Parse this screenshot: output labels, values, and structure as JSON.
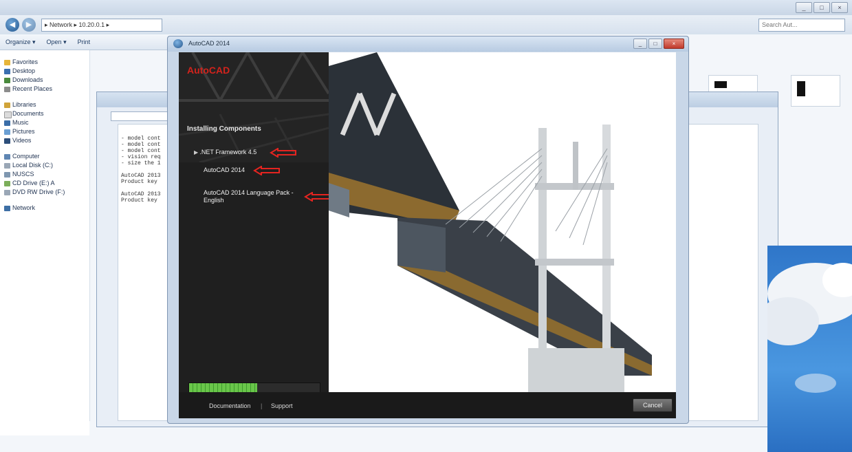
{
  "explorer": {
    "address": "▸ Network ▸ 10.20.0.1 ▸",
    "search_placeholder": "Search Aut...",
    "toolbar": {
      "organize": "Organize ▾",
      "open": "Open ▾",
      "print": "Print"
    },
    "nav_favorites": [
      "Favorites",
      "Desktop",
      "Downloads",
      "Recent Places"
    ],
    "nav_libraries": [
      "Libraries",
      "Documents",
      "Music",
      "Pictures",
      "Videos"
    ],
    "nav_computer": [
      "Computer",
      "Local Disk (C:)",
      "NUSCS",
      "CD Drive (E:) A",
      "DVD RW Drive (F:)"
    ],
    "nav_network": "Network"
  },
  "notepad": {
    "lines": [
      "- model cont",
      "- model cont",
      "- model cont",
      "- vision req",
      "- size the 1",
      "",
      "AutoCAD 2013",
      "Product key",
      "",
      "AutoCAD 2013",
      "Product key"
    ]
  },
  "installer": {
    "title": "AutoCAD 2014",
    "logo": "AutoCAD",
    "section_heading": "Installing Components",
    "components": [
      {
        "label": ".NET Framework 4.5"
      },
      {
        "label": "AutoCAD 2014"
      },
      {
        "label": "AutoCAD 2014 Language Pack - English"
      }
    ],
    "progress": 0.52,
    "footer": {
      "documentation": "Documentation",
      "separator": "|",
      "support": "Support",
      "cancel": "Cancel"
    },
    "accent_color": "#d2231c",
    "progress_color": "#5cbf3f"
  }
}
